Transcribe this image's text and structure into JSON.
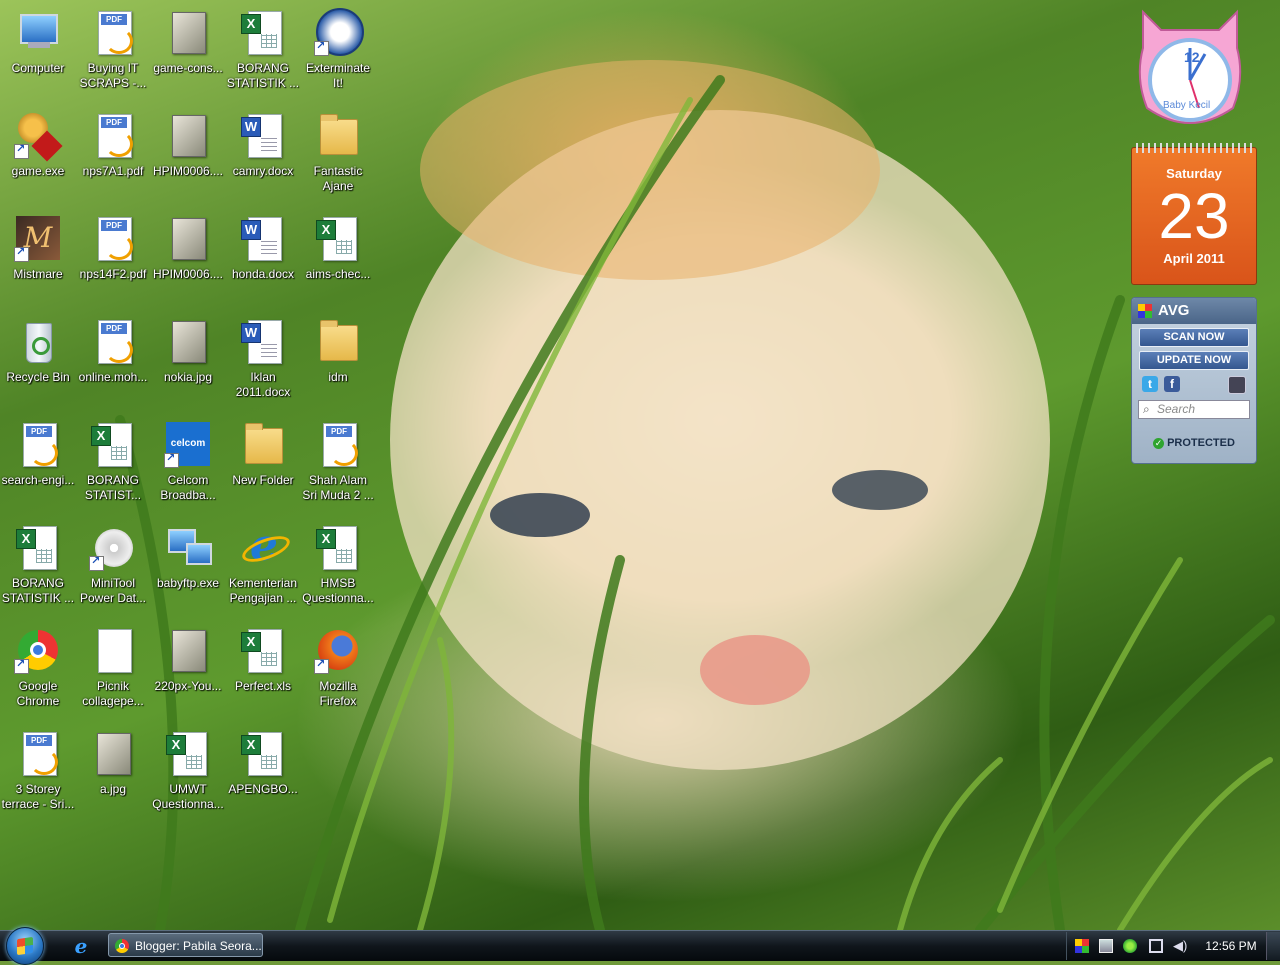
{
  "desktop": {
    "icons": [
      {
        "label": "Computer",
        "icon": "computer-icon"
      },
      {
        "label": "Buying IT SCRAPS -...",
        "icon": "pdf-icon"
      },
      {
        "label": "game-cons...",
        "icon": "image-icon"
      },
      {
        "label": "BORANG STATISTIK ...",
        "icon": "excel-icon"
      },
      {
        "label": "Exterminate It!",
        "icon": "exterminate-it-icon"
      },
      {
        "label": "game.exe",
        "icon": "game-exe-icon"
      },
      {
        "label": "nps7A1.pdf",
        "icon": "pdf-icon"
      },
      {
        "label": "HPIM0006....",
        "icon": "image-icon"
      },
      {
        "label": "camry.docx",
        "icon": "word-icon"
      },
      {
        "label": "Fantastic Ajane",
        "icon": "folder-icon"
      },
      {
        "label": "Mistmare",
        "icon": "mistmare-icon"
      },
      {
        "label": "nps14F2.pdf",
        "icon": "pdf-icon"
      },
      {
        "label": "HPIM0006....",
        "icon": "image-icon"
      },
      {
        "label": "honda.docx",
        "icon": "word-icon"
      },
      {
        "label": "aims-chec...",
        "icon": "excel-icon"
      },
      {
        "label": "Recycle Bin",
        "icon": "recycle-bin-icon"
      },
      {
        "label": "online.moh...",
        "icon": "pdf-icon"
      },
      {
        "label": "nokia.jpg",
        "icon": "image-icon"
      },
      {
        "label": "Iklan 2011.docx",
        "icon": "word-icon"
      },
      {
        "label": "idm",
        "icon": "folder-icon"
      },
      {
        "label": "search-engi...",
        "icon": "pdf-icon"
      },
      {
        "label": "BORANG STATIST...",
        "icon": "excel-icon"
      },
      {
        "label": "Celcom Broadba...",
        "icon": "celcom-icon"
      },
      {
        "label": "New Folder",
        "icon": "folder-icon"
      },
      {
        "label": "Shah Alam Sri Muda 2 ...",
        "icon": "pdf-icon"
      },
      {
        "label": "BORANG STATISTIK ...",
        "icon": "excel-icon"
      },
      {
        "label": "MiniTool Power Dat...",
        "icon": "disc-icon"
      },
      {
        "label": "babyftp.exe",
        "icon": "network-icon"
      },
      {
        "label": "Kementerian Pengajian ...",
        "icon": "internet-explorer-icon"
      },
      {
        "label": "HMSB Questionna...",
        "icon": "excel-icon"
      },
      {
        "label": "Google Chrome",
        "icon": "chrome-icon"
      },
      {
        "label": "Picnik collagepe...",
        "icon": "blank-file-icon"
      },
      {
        "label": "220px-You...",
        "icon": "image-icon"
      },
      {
        "label": "Perfect.xls",
        "icon": "excel-icon"
      },
      {
        "label": "Mozilla Firefox",
        "icon": "firefox-icon"
      },
      {
        "label": "3 Storey terrace - Sri...",
        "icon": "pdf-icon"
      },
      {
        "label": "a.jpg",
        "icon": "image-icon"
      },
      {
        "label": "UMWT Questionna...",
        "icon": "excel-icon"
      },
      {
        "label": "APENGBO...",
        "icon": "excel-icon"
      }
    ]
  },
  "gadgets": {
    "clock": {
      "brand": "Baby Kecil",
      "numeral": "12"
    },
    "calendar": {
      "day": "Saturday",
      "date": "23",
      "month_year": "April 2011"
    },
    "avg": {
      "title": "AVG",
      "scan_label": "SCAN NOW",
      "update_label": "UPDATE NOW",
      "search_placeholder": "Search",
      "status": "PROTECTED",
      "twitter": "t",
      "facebook": "f"
    }
  },
  "taskbar": {
    "task_label": "Blogger: Pabila Seora...",
    "quick_launch_glyph": "e",
    "time": "12:56 PM"
  },
  "colors": {
    "calendar_orange": "#e0621f",
    "taskbar_dark": "#10161c",
    "avg_blue": "#34578f"
  }
}
